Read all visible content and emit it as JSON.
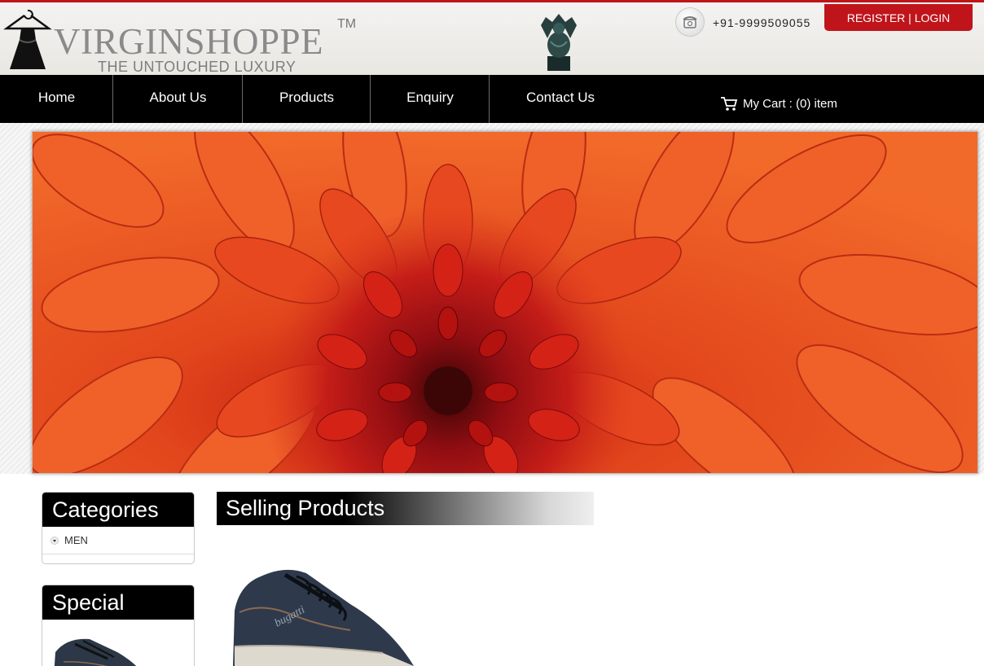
{
  "brand": {
    "name": "VIRGINSHOPPE",
    "trademark": "TM",
    "tagline": "THE UNTOUCHED LUXURY"
  },
  "contact": {
    "phone": "+91-9999509055"
  },
  "auth": {
    "label": "REGISTER | LOGIN"
  },
  "nav": {
    "items": [
      {
        "label": "Home"
      },
      {
        "label": "About Us"
      },
      {
        "label": "Products"
      },
      {
        "label": "Enquiry"
      },
      {
        "label": "Contact Us"
      }
    ],
    "cart_label": "My Cart : (0) item"
  },
  "sidebar": {
    "categories_title": "Categories",
    "categories": [
      {
        "label": "MEN"
      }
    ],
    "special_title": "Special"
  },
  "main": {
    "section_title": "Selling Products"
  },
  "colors": {
    "accent": "#c0141b",
    "nav_bg": "#000000",
    "banner": "#e2461c"
  }
}
